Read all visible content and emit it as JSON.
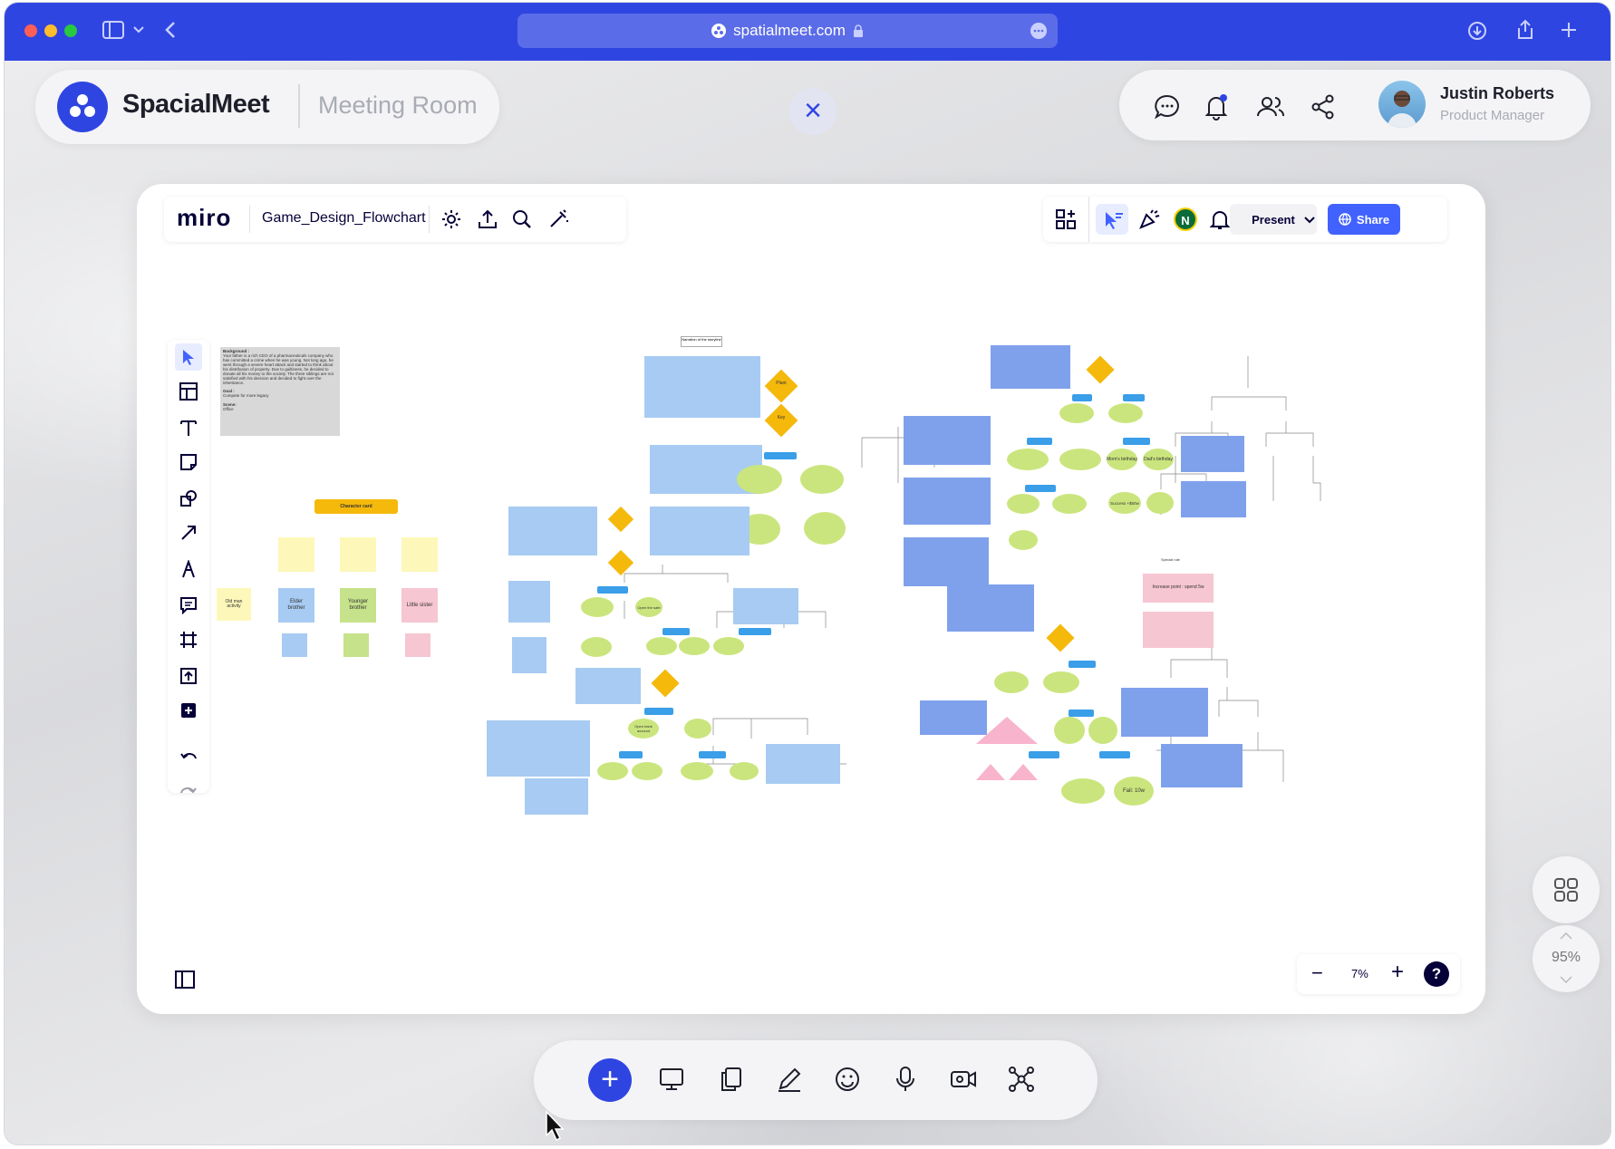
{
  "browser": {
    "url": "spatialmeet.com"
  },
  "app": {
    "brand": "SpacialMeet",
    "room": "Meeting Room"
  },
  "user": {
    "name": "Justin Roberts",
    "role": "Product Manager"
  },
  "miro": {
    "logo": "miro",
    "board_name": "Game_Design_Flowchart",
    "present_label": "Present",
    "share_label": "Share",
    "avatar_initial": "N",
    "zoom": "7%",
    "help": "?"
  },
  "board": {
    "background_title": "Background :",
    "background_text": "Your father is a rich CEO of a pharmaceuticals company who has committed a crime when he was young. Not long ago, he went through a severe heart attack and started to think about his distribution of property. Due to guiltiness, he decided to donate all his money to the society. The three siblings are not satisfied with his decision and decided to fight over the inheritance.",
    "goal": "Goal :",
    "goal_text": "Compete for more legacy",
    "scene": "Scene:",
    "scene_text": "Office",
    "character_card": "Character card",
    "elder_brother": "Elder brother",
    "younger_brother": "Younger brother",
    "little_sister": "Little sister",
    "old_man": "Old man activity",
    "narration_title": "Narration of the storyline",
    "plant": "Plant",
    "key": "Key",
    "increase_point": "Increase point : spend 5w",
    "special_rule": "Special rule",
    "moms_birthday": "Mom's birthday",
    "dads_birthday": "Dad's birthday",
    "fail": "Fail: 10w",
    "success": "Success +$50w",
    "open_the_safe": "Open the safe",
    "open_bank_account": "Open bank account"
  },
  "dock": {
    "zoom": "95%"
  },
  "colors": {
    "brand": "#2f45e2",
    "miro_blue": "#4262ff",
    "diamond": "#f5b90c"
  }
}
